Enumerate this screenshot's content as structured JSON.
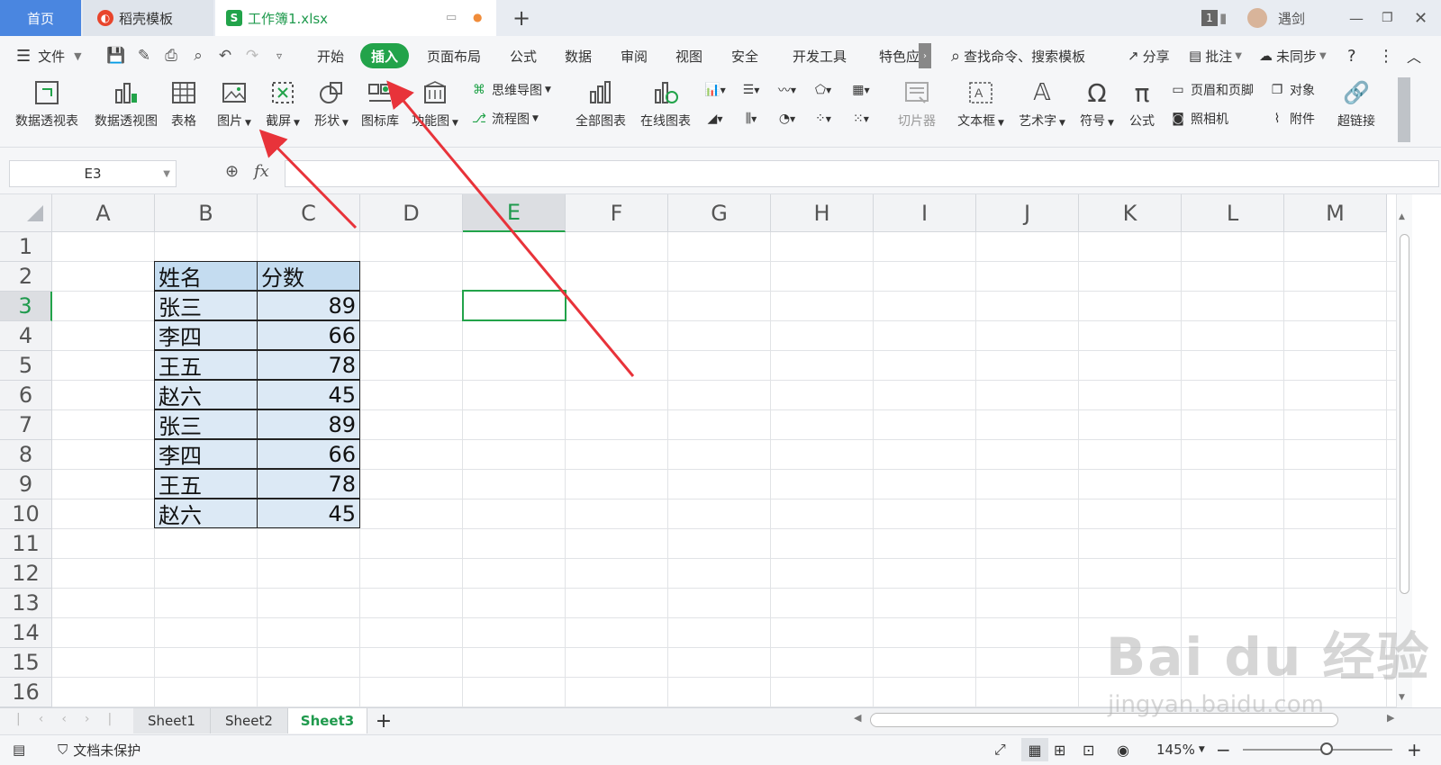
{
  "tabs": {
    "home": "首页",
    "template": "稻壳模板",
    "workbook": "工作簿1.xlsx",
    "workbook_icon": "S"
  },
  "titlebar": {
    "badge": "1",
    "user": "遇剑"
  },
  "menu": {
    "file": "文件",
    "items": [
      "开始",
      "插入",
      "页面布局",
      "公式",
      "数据",
      "审阅",
      "视图",
      "安全",
      "开发工具",
      "特色应"
    ],
    "active": "插入",
    "search": "查找命令、搜索模板",
    "share": "分享",
    "comment": "批注",
    "sync": "未同步"
  },
  "ribbon": {
    "pivot_table": "数据透视表",
    "pivot_chart": "数据透视图",
    "table": "表格",
    "picture": "图片",
    "screenshot": "截屏",
    "shape": "形状",
    "icon_lib": "图标库",
    "function_chart": "功能图",
    "mindmap": "思维导图",
    "flowchart": "流程图",
    "all_charts": "全部图表",
    "online_chart": "在线图表",
    "slicer": "切片器",
    "textbox": "文本框",
    "wordart": "艺术字",
    "symbol": "符号",
    "formula": "公式",
    "header_footer": "页眉和页脚",
    "object": "对象",
    "camera": "照相机",
    "attachment": "附件",
    "hyperlink": "超链接"
  },
  "formula_bar": {
    "cell_ref": "E3",
    "fx": "fx",
    "value": ""
  },
  "grid": {
    "columns": [
      "A",
      "B",
      "C",
      "D",
      "E",
      "F",
      "G",
      "H",
      "I",
      "J",
      "K",
      "L",
      "M"
    ],
    "rows": [
      "1",
      "2",
      "3",
      "4",
      "5",
      "6",
      "7",
      "8",
      "9",
      "10",
      "11",
      "12",
      "13",
      "14",
      "15",
      "16"
    ],
    "selected_col": "E",
    "selected_row": "3",
    "table_header": [
      "姓名",
      "分数"
    ],
    "table_rows": [
      [
        "张三",
        "89"
      ],
      [
        "李四",
        "66"
      ],
      [
        "王五",
        "78"
      ],
      [
        "赵六",
        "45"
      ],
      [
        "张三",
        "89"
      ],
      [
        "李四",
        "66"
      ],
      [
        "王五",
        "78"
      ],
      [
        "赵六",
        "45"
      ]
    ]
  },
  "sheets": [
    "Sheet1",
    "Sheet2",
    "Sheet3"
  ],
  "active_sheet": "Sheet3",
  "status": {
    "protect": "文档未保护",
    "zoom": "145%"
  },
  "watermark": {
    "main": "Bai du 经验",
    "sub": "jingyan.baidu.com"
  },
  "colors": {
    "accent": "#22a34a",
    "home_tab": "#4a86e0",
    "cell_fill": "#dce9f5",
    "header_fill": "#c4dcf0",
    "arrow": "#e8333a"
  }
}
